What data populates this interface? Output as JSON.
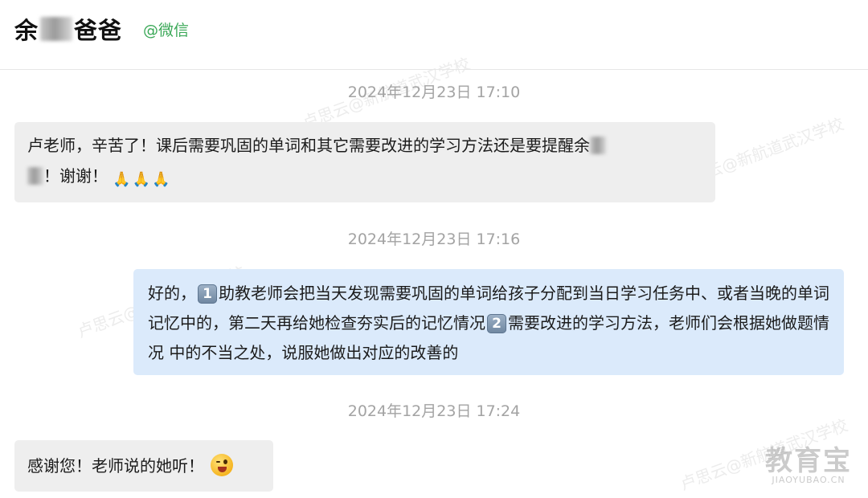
{
  "header": {
    "name_prefix": "余",
    "name_suffix": "爸爸",
    "source_tag": "@微信"
  },
  "messages": [
    {
      "timestamp": "2024年12月23日 17:10",
      "direction": "incoming",
      "line1": "卢老师，辛苦了！课后需要巩固的单词和其它需要改进的学习方法还是要提醒余",
      "line2": "！谢谢！",
      "emoji": "folded-hands-x3"
    },
    {
      "timestamp": "2024年12月23日 17:16",
      "direction": "outgoing",
      "part1": "好的，",
      "badge1": "1",
      "part2": "助教老师会把当天发现需要巩固的单词给孩子分配到当日学习任务中、或者当晚的单词记忆中的，第二天再给她检查夯实后的记忆情况",
      "badge2": "2",
      "part3": "需要改进的学习方法，老师们会根据她做题情况 中的不当之处，说服她做出对应的改善的"
    },
    {
      "timestamp": "2024年12月23日 17:24",
      "direction": "incoming",
      "text": "感谢您！老师说的她听！",
      "emoji": "winking-face-tongue"
    }
  ],
  "watermarks": [
    "卢思云@新航道武汉学校",
    "卢思云@新航道武汉学校",
    "卢思云@新航道武汉学校",
    "卢思云@新航道武汉学校"
  ],
  "logo": {
    "text": "教育宝",
    "sub": "JIAOYUBAO.CN"
  },
  "colors": {
    "incoming_bubble": "#eeeeee",
    "outgoing_bubble": "#dbeafb",
    "tag_green": "#3aa857"
  }
}
